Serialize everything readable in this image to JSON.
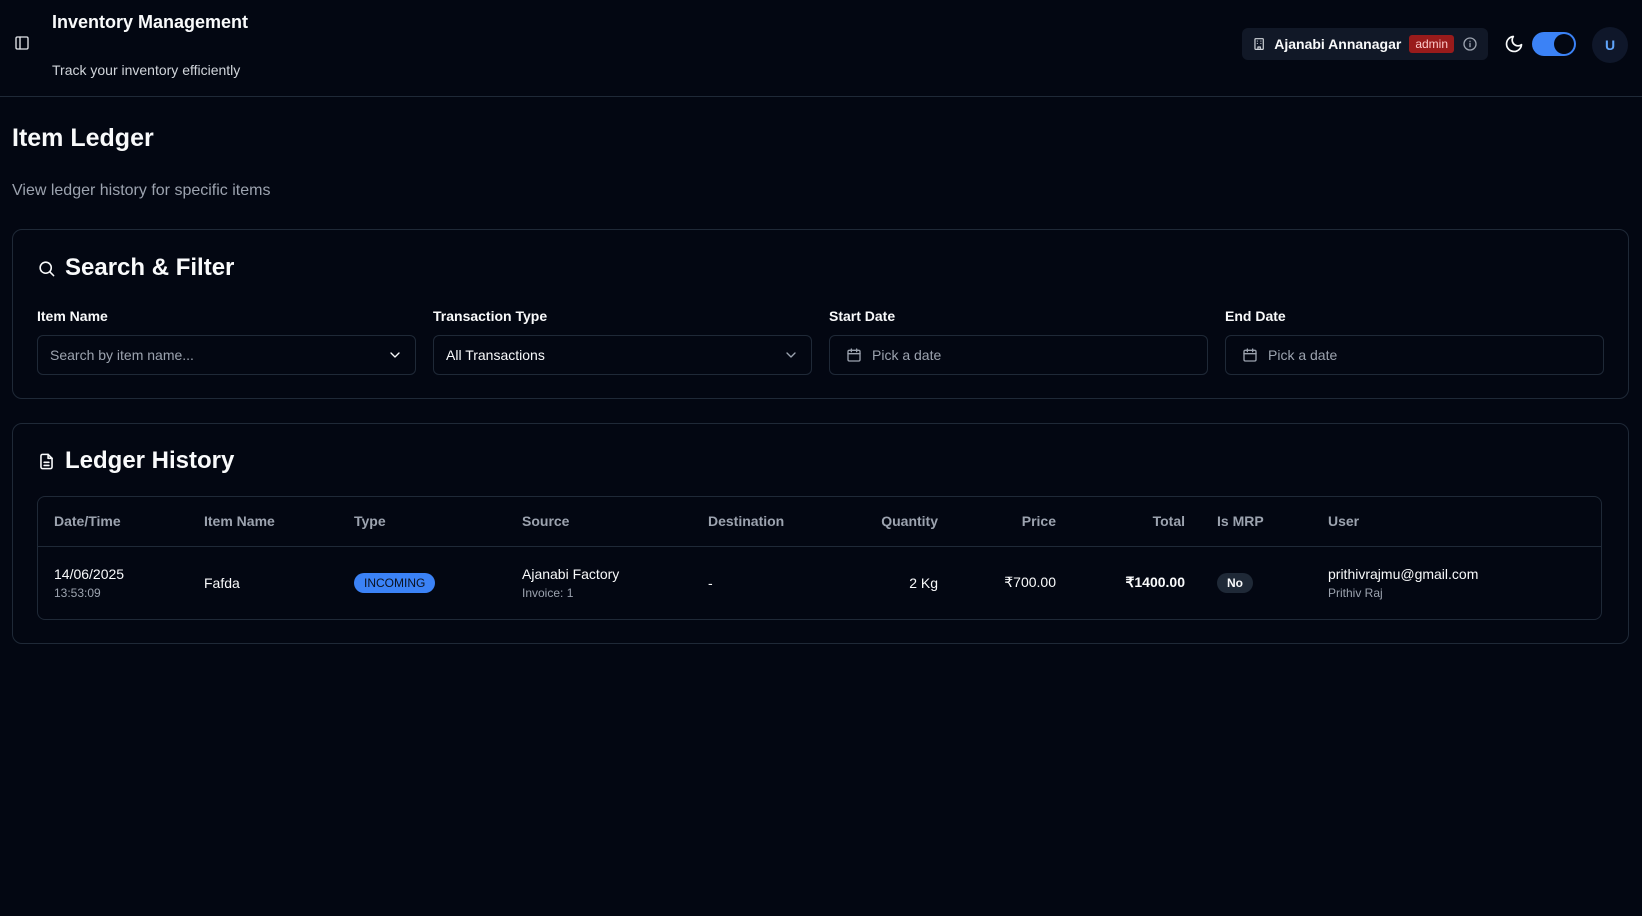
{
  "header": {
    "title": "Inventory Management",
    "subtitle": "Track your inventory efficiently",
    "store_name": "Ajanabi Annanagar",
    "role": "admin",
    "avatar_initial": "U",
    "theme_toggle_on": true
  },
  "page": {
    "title": "Item Ledger",
    "subtitle": "View ledger history for specific items"
  },
  "filter": {
    "title": "Search & Filter",
    "item_name_label": "Item Name",
    "item_name_placeholder": "Search by item name...",
    "transaction_type_label": "Transaction Type",
    "transaction_type_value": "All Transactions",
    "start_date_label": "Start Date",
    "start_date_placeholder": "Pick a date",
    "end_date_label": "End Date",
    "end_date_placeholder": "Pick a date"
  },
  "ledger": {
    "title": "Ledger History",
    "columns": [
      "Date/Time",
      "Item Name",
      "Type",
      "Source",
      "Destination",
      "Quantity",
      "Price",
      "Total",
      "Is MRP",
      "User"
    ],
    "rows": [
      {
        "date": "14/06/2025",
        "time": "13:53:09",
        "item_name": "Fafda",
        "type": "INCOMING",
        "source": "Ajanabi Factory",
        "source_detail": "Invoice: 1",
        "destination": "-",
        "quantity": "2 Kg",
        "price": "₹700.00",
        "total": "₹1400.00",
        "is_mrp": "No",
        "user_email": "prithivrajmu@gmail.com",
        "user_name": "Prithiv Raj"
      }
    ]
  },
  "colors": {
    "background": "#030712",
    "accent": "#3b82f6",
    "role_badge": "#991b1b",
    "border": "#1f2937"
  },
  "icons": {
    "sidebar_toggle": "panel-left-icon",
    "store": "building-icon",
    "info": "info-icon",
    "theme": "moon-icon",
    "search": "search-icon",
    "calendar": "calendar-icon",
    "chevron": "chevron-down-icon",
    "document": "file-text-icon"
  }
}
